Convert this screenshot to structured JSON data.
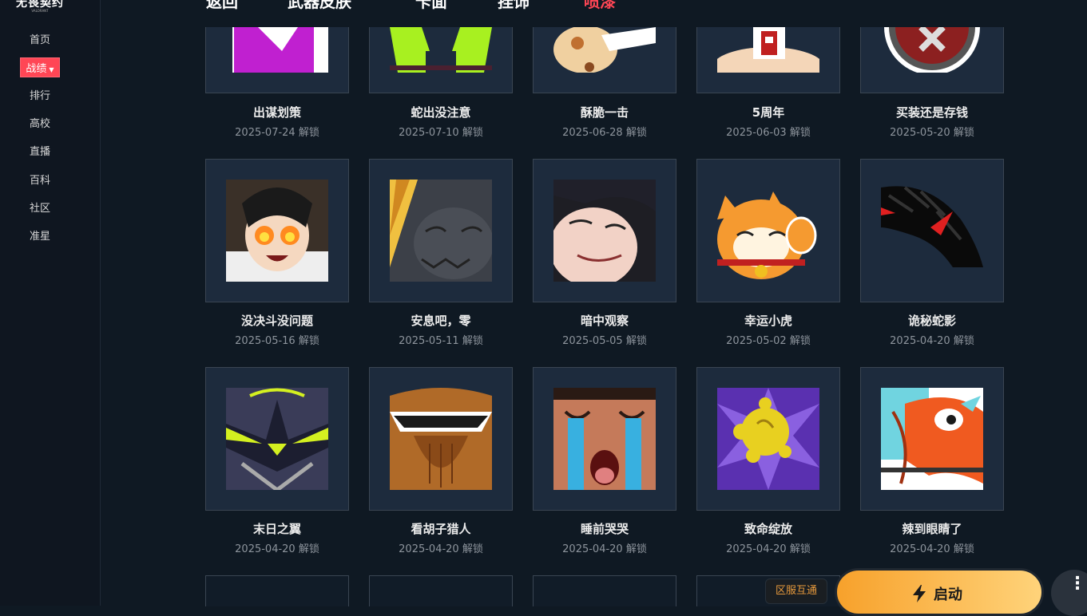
{
  "sidebar": {
    "logo": "无畏契约",
    "logo_sub": "VALORANT",
    "items": [
      {
        "label": "首页"
      },
      {
        "label": "战绩"
      },
      {
        "label": "排行"
      },
      {
        "label": "高校"
      },
      {
        "label": "直播"
      },
      {
        "label": "百科"
      },
      {
        "label": "社区"
      },
      {
        "label": "准星"
      }
    ]
  },
  "tabs": [
    "返回",
    "武器皮肤",
    "卡面",
    "挂饰",
    "喷漆"
  ],
  "cards": [
    {
      "title": "出谋划策",
      "date": "2025-07-24 解锁"
    },
    {
      "title": "蛇出没注意",
      "date": "2025-07-10 解锁"
    },
    {
      "title": "酥脆一击",
      "date": "2025-06-28 解锁"
    },
    {
      "title": "5周年",
      "date": "2025-06-03 解锁"
    },
    {
      "title": "买装还是存钱",
      "date": "2025-05-20 解锁"
    },
    {
      "title": "没决斗没问题",
      "date": "2025-05-16 解锁"
    },
    {
      "title": "安息吧，零",
      "date": "2025-05-11 解锁"
    },
    {
      "title": "暗中观察",
      "date": "2025-05-05 解锁"
    },
    {
      "title": "幸运小虎",
      "date": "2025-05-02 解锁"
    },
    {
      "title": "诡秘蛇影",
      "date": "2025-04-20 解锁"
    },
    {
      "title": "末日之翼",
      "date": "2025-04-20 解锁"
    },
    {
      "title": "看胡子猎人",
      "date": "2025-04-20 解锁"
    },
    {
      "title": "睡前哭哭",
      "date": "2025-04-20 解锁"
    },
    {
      "title": "致命绽放",
      "date": "2025-04-20 解锁"
    },
    {
      "title": "辣到眼睛了",
      "date": "2025-04-20 解锁"
    }
  ],
  "footer": {
    "region_label": "区服互通",
    "launch_label": "启动",
    "launch_icon": "lightning-icon",
    "more_icon": "more-vertical-icon"
  },
  "colors": {
    "accent": "#ff4655",
    "launch": "#f7a12b",
    "background": "#0f1923"
  }
}
